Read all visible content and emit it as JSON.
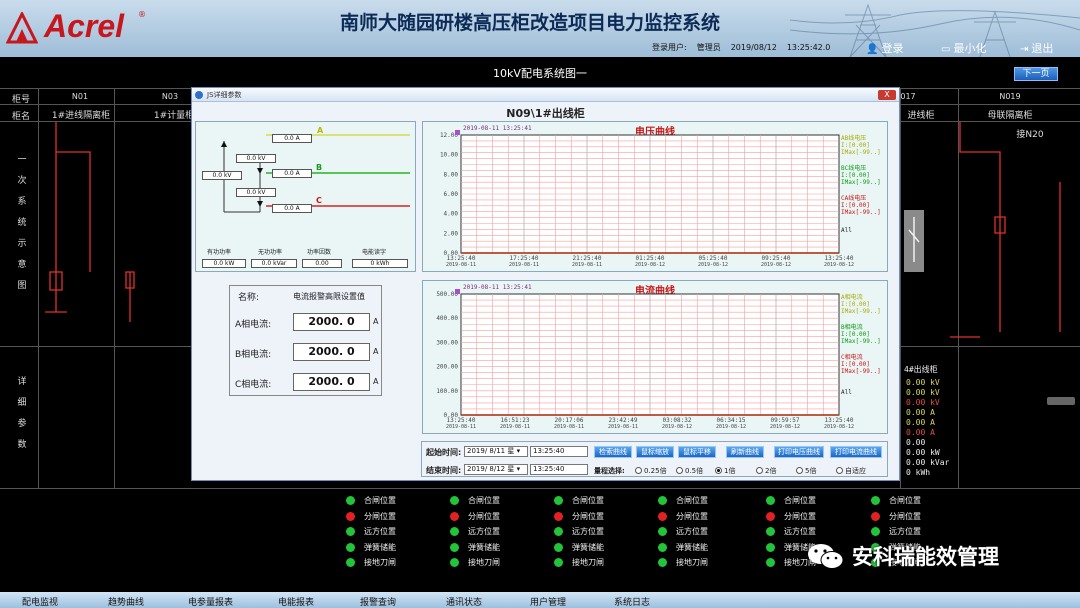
{
  "header": {
    "logo_text": "Acrel",
    "title": "南师大随园研楼高压柜改造项目电力监控系统",
    "user_label": "登录用户:",
    "user_name": "管理员",
    "date": "2019/08/12",
    "time": "13:25:42.0",
    "login_btn": "登录",
    "minimize_btn": "最小化",
    "exit_btn": "退出"
  },
  "subbar": {
    "diagram_title": "10kV配电系统图一",
    "next_page": "下一页"
  },
  "grid": {
    "row_labels": [
      "柜号",
      "柜名"
    ],
    "section1": [
      "一",
      "次",
      "系",
      "统",
      "示",
      "意",
      "图"
    ],
    "section2": [
      "详",
      "细",
      "参",
      "数"
    ],
    "cabinets": [
      {
        "no": "N01",
        "name": "1#进线隔离柜"
      },
      {
        "no": "N03",
        "name": "1#计量柜"
      },
      {
        "no": "017",
        "name": "进线柜"
      },
      {
        "no": "N019",
        "name": "母联隔离柜"
      }
    ],
    "right_link": "接N20",
    "right_feeder": "4#出线柜",
    "right_values": [
      "0.00 kV",
      "0.00 kV",
      "0.00 kV",
      "0.00 A",
      "0.00 A",
      "0.00 A",
      "0.00",
      "0.00 kW",
      "0.00 kVar",
      "0 kWh"
    ]
  },
  "status_labels": [
    "合闸位置",
    "分闸位置",
    "远方位置",
    "弹簧储能",
    "接地刀闸"
  ],
  "status_columns": 6,
  "nav": [
    "配电监视",
    "趋势曲线",
    "电参量报表",
    "电能报表",
    "报警查询",
    "通讯状态",
    "用户管理",
    "系统日志"
  ],
  "watermark": "安科瑞能效管理",
  "dialog": {
    "window_title": "JS详细参数",
    "heading": "N09\\1#出线柜",
    "close": "X",
    "wiring": {
      "phase_labels": [
        "A",
        "B",
        "C"
      ],
      "boxes": [
        {
          "value": "0.0",
          "unit": "A"
        },
        {
          "value": "0.0",
          "unit": "kV"
        },
        {
          "value": "0.0",
          "unit": "kV"
        },
        {
          "value": "0.0",
          "unit": "A"
        },
        {
          "value": "0.0",
          "unit": "kV"
        },
        {
          "value": "0.0",
          "unit": "A"
        }
      ],
      "measurements": [
        {
          "label": "有功功率",
          "value": "0.0",
          "unit": "kW"
        },
        {
          "label": "无功功率",
          "value": "0.0",
          "unit": "kVar"
        },
        {
          "label": "功率因数",
          "value": "0.00",
          "unit": ""
        },
        {
          "label": "电能读字",
          "value": "0",
          "unit": "kWh"
        }
      ]
    },
    "alarm": {
      "name_header": "名称:",
      "setting_header": "电流报警高限设置值",
      "rows": [
        {
          "label": "A相电流:",
          "value": "2000. 0",
          "unit": "A"
        },
        {
          "label": "B相电流:",
          "value": "2000. 0",
          "unit": "A"
        },
        {
          "label": "C相电流:",
          "value": "2000. 0",
          "unit": "A"
        }
      ]
    },
    "voltage_chart": {
      "title": "电压曲线",
      "timestamp": "2019-08-11 13:25:41",
      "y_ticks": [
        "12.00",
        "10.00",
        "8.00",
        "6.00",
        "4.00",
        "2.00",
        "0.00"
      ],
      "x_ticks": [
        {
          "t": "13:25:40",
          "d": "2019-08-11"
        },
        {
          "t": "17:25:40",
          "d": "2019-08-11"
        },
        {
          "t": "21:25:40",
          "d": "2019-08-11"
        },
        {
          "t": "01:25:40",
          "d": "2019-08-12"
        },
        {
          "t": "05:25:40",
          "d": "2019-08-12"
        },
        {
          "t": "09:25:40",
          "d": "2019-08-12"
        },
        {
          "t": "13:25:40",
          "d": "2019-08-12"
        }
      ],
      "legend": [
        {
          "name": "AB线电压",
          "l1": "I:[0.00]",
          "l2": "IMax[-99..]",
          "color": "#a9a900"
        },
        {
          "name": "BC线电压",
          "l1": "I:[0.00]",
          "l2": "IMax[-99..]",
          "color": "#0c9a0c"
        },
        {
          "name": "CA线电压",
          "l1": "I:[0.00]",
          "l2": "IMax[-99..]",
          "color": "#c81515"
        }
      ],
      "legend_all": "All"
    },
    "current_chart": {
      "title": "电流曲线",
      "timestamp": "2019-08-11 13:25:41",
      "y_ticks": [
        "500.00",
        "400.00",
        "300.00",
        "200.00",
        "100.00",
        "0.00"
      ],
      "x_ticks": [
        {
          "t": "13:25:40",
          "d": "2019-08-11"
        },
        {
          "t": "16:51:23",
          "d": "2019-08-11"
        },
        {
          "t": "20:17:06",
          "d": "2019-08-11"
        },
        {
          "t": "23:42:49",
          "d": "2019-08-11"
        },
        {
          "t": "03:08:32",
          "d": "2019-08-12"
        },
        {
          "t": "06:34:15",
          "d": "2019-08-12"
        },
        {
          "t": "09:59:57",
          "d": "2019-08-12"
        },
        {
          "t": "13:25:40",
          "d": "2019-08-12"
        }
      ],
      "legend": [
        {
          "name": "A相电流",
          "l1": "I:[0.00]",
          "l2": "IMax[-99..]",
          "color": "#a9a900"
        },
        {
          "name": "B相电流",
          "l1": "I:[0.00]",
          "l2": "IMax[-99..]",
          "color": "#0c9a0c"
        },
        {
          "name": "C相电流",
          "l1": "I:[0.00]",
          "l2": "IMax[-99..]",
          "color": "#c81515"
        }
      ],
      "legend_all": "All"
    },
    "time_controls": {
      "start_label": "起始时间:",
      "end_label": "结束时间:",
      "start_date": "2019/ 8/11 星 ▾",
      "start_time": "13:25:40",
      "end_date": "2019/ 8/12 星 ▾",
      "end_time": "13:25:40",
      "buttons": [
        "检索曲线",
        "鼠标缩放",
        "鼠标平移",
        "刷新曲线",
        "打印电压曲线",
        "打印电流曲线"
      ],
      "scale_label": "量程选择:",
      "scale_options": [
        "0.25倍",
        "0.5倍",
        "1倍",
        "2倍",
        "5倍",
        "自适应"
      ],
      "scale_selected": "1倍"
    }
  },
  "chart_data": [
    {
      "type": "line",
      "title": "电压曲线",
      "ylim": [
        0,
        12
      ],
      "x": [
        "2019-08-11 13:25:40",
        "2019-08-12 13:25:40"
      ],
      "series": [
        {
          "name": "AB线电压",
          "values": [
            0,
            0
          ]
        },
        {
          "name": "BC线电压",
          "values": [
            0,
            0
          ]
        },
        {
          "name": "CA线电压",
          "values": [
            0,
            0
          ]
        }
      ]
    },
    {
      "type": "line",
      "title": "电流曲线",
      "ylim": [
        0,
        500
      ],
      "x": [
        "2019-08-11 13:25:40",
        "2019-08-12 13:25:40"
      ],
      "series": [
        {
          "name": "A相电流",
          "values": [
            0,
            0
          ]
        },
        {
          "name": "B相电流",
          "values": [
            0,
            0
          ]
        },
        {
          "name": "C相电流",
          "values": [
            0,
            0
          ]
        }
      ]
    }
  ]
}
